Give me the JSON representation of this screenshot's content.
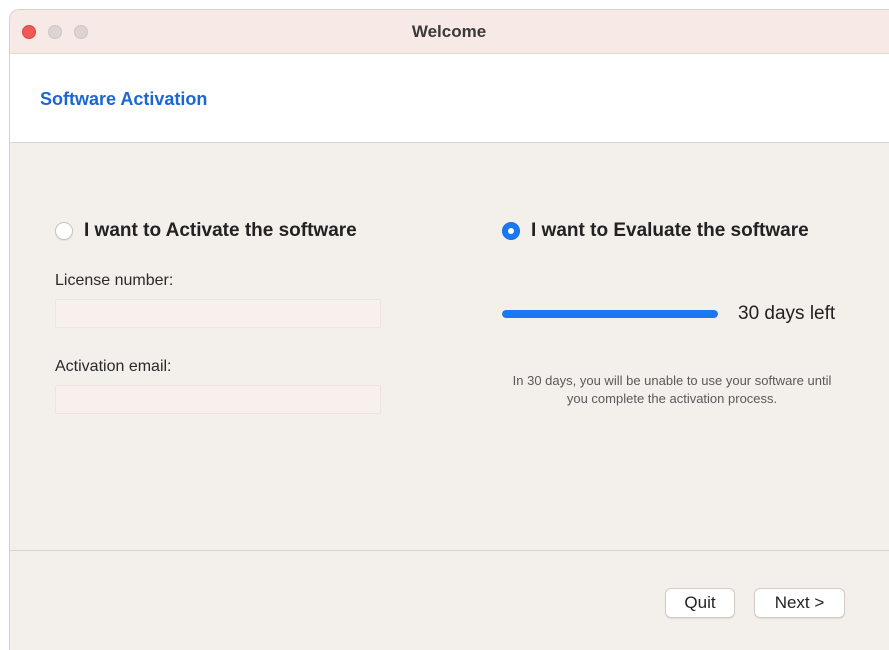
{
  "window": {
    "title": "Welcome"
  },
  "header": {
    "title": "Software Activation"
  },
  "activate": {
    "option_label": "I want to Activate the software",
    "selected": false,
    "license_label": "License number:",
    "license_value": "",
    "email_label": "Activation email:",
    "email_value": ""
  },
  "evaluate": {
    "option_label": "I want to Evaluate the software",
    "selected": true,
    "progress_fraction": 1.0,
    "days_left_text": "30 days left",
    "note": "In 30 days, you will be unable to use your software until you complete the activation process."
  },
  "footer": {
    "quit_label": "Quit",
    "next_label": "Next >"
  },
  "colors": {
    "accent": "#1a78f2",
    "header_title": "#1a67d4",
    "close_button": "#ee5a54"
  },
  "icons": {
    "close": "traffic-close-icon",
    "minimize": "traffic-minimize-icon",
    "zoom": "traffic-zoom-icon"
  }
}
